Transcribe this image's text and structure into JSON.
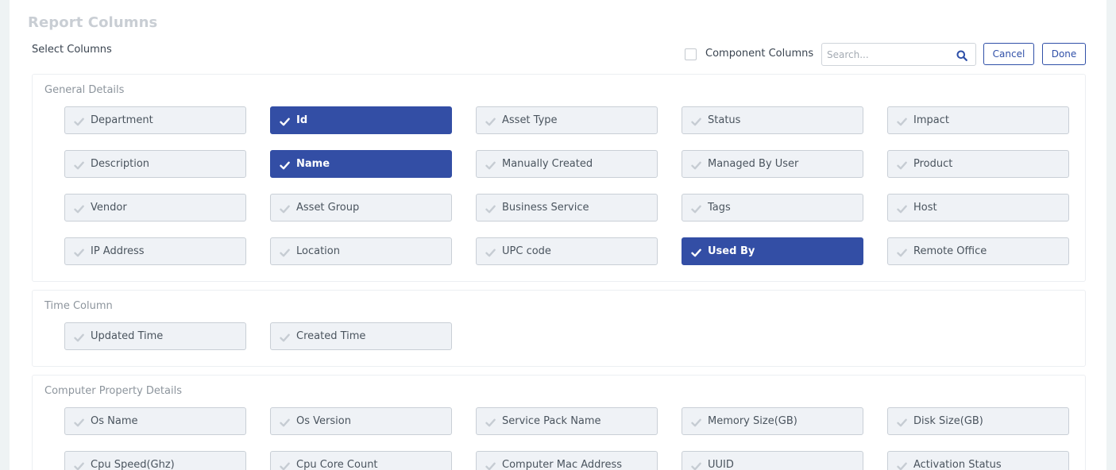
{
  "header": {
    "title": "Report Columns",
    "subtitle": "Select Columns"
  },
  "toolbar": {
    "component_columns_label": "Component Columns",
    "component_columns_checked": false,
    "search_placeholder": "Search...",
    "cancel_label": "Cancel",
    "done_label": "Done"
  },
  "colors": {
    "selected": "#334ea5",
    "unselected": "#eff2f6",
    "accent": "#3050a8"
  },
  "sections": [
    {
      "title": "General Details",
      "items": [
        {
          "label": "Department",
          "selected": false
        },
        {
          "label": "Id",
          "selected": true
        },
        {
          "label": "Asset Type",
          "selected": false
        },
        {
          "label": "Status",
          "selected": false
        },
        {
          "label": "Impact",
          "selected": false
        },
        {
          "label": "Description",
          "selected": false
        },
        {
          "label": "Name",
          "selected": true
        },
        {
          "label": "Manually Created",
          "selected": false
        },
        {
          "label": "Managed By User",
          "selected": false
        },
        {
          "label": "Product",
          "selected": false
        },
        {
          "label": "Vendor",
          "selected": false
        },
        {
          "label": "Asset Group",
          "selected": false
        },
        {
          "label": "Business Service",
          "selected": false
        },
        {
          "label": "Tags",
          "selected": false
        },
        {
          "label": "Host",
          "selected": false
        },
        {
          "label": "IP Address",
          "selected": false
        },
        {
          "label": "Location",
          "selected": false
        },
        {
          "label": "UPC code",
          "selected": false
        },
        {
          "label": "Used By",
          "selected": true
        },
        {
          "label": "Remote Office",
          "selected": false
        }
      ]
    },
    {
      "title": "Time Column",
      "items": [
        {
          "label": "Updated Time",
          "selected": false
        },
        {
          "label": "Created Time",
          "selected": false
        }
      ]
    },
    {
      "title": "Computer Property Details",
      "items": [
        {
          "label": "Os Name",
          "selected": false
        },
        {
          "label": "Os Version",
          "selected": false
        },
        {
          "label": "Service Pack Name",
          "selected": false
        },
        {
          "label": "Memory Size(GB)",
          "selected": false
        },
        {
          "label": "Disk Size(GB)",
          "selected": false
        },
        {
          "label": "Cpu Speed(Ghz)",
          "selected": false
        },
        {
          "label": "Cpu Core Count",
          "selected": false
        },
        {
          "label": "Computer Mac Address",
          "selected": false
        },
        {
          "label": "UUID",
          "selected": false
        },
        {
          "label": "Activation Status",
          "selected": false
        }
      ]
    }
  ]
}
